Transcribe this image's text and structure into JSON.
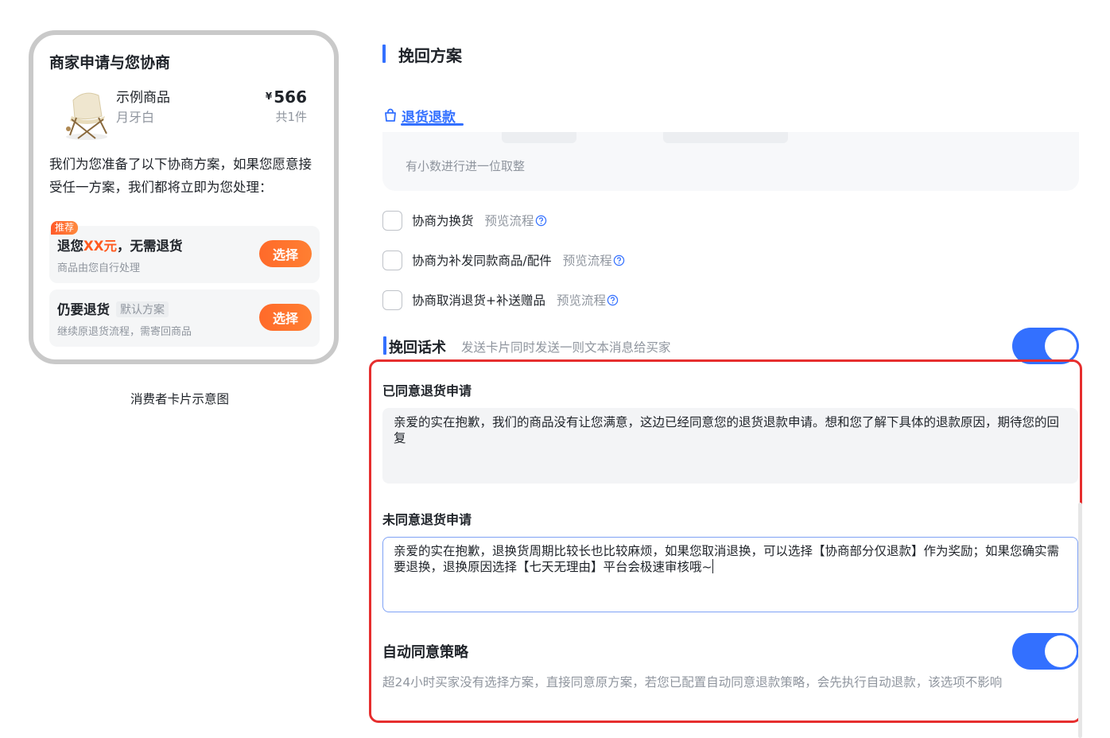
{
  "card": {
    "title": "商家申请与您协商",
    "product_name": "示例商品",
    "product_spec": "月牙白",
    "price_symbol": "¥",
    "price": "566",
    "quantity": "共1件",
    "description": "我们为您准备了以下协商方案，如果您愿意接受任一方案，我们都将立即为您处理：",
    "recommend_tag": "推荐",
    "option1": {
      "title_prefix": "退您",
      "title_amount": "XX元",
      "title_suffix": "，无需退货",
      "subtitle": "商品由您自行处理",
      "button": "选择"
    },
    "option2": {
      "title": "仍要退货",
      "badge": "默认方案",
      "subtitle": "继续原退货流程，需寄回商品",
      "button": "选择"
    },
    "caption": "消费者卡片示意图"
  },
  "panel": {
    "plan_title": "挽回方案",
    "tab_label": "退货退款",
    "clipped_note": "有小数进行进一位取整",
    "checkboxes": [
      {
        "label": "协商为换货",
        "link": "预览流程"
      },
      {
        "label": "协商为补发同款商品/配件",
        "link": "预览流程"
      },
      {
        "label": "协商取消退货+补送赠品",
        "link": "预览流程"
      }
    ],
    "script_title": "挽回话术",
    "script_hint": "发送卡片同时发送一则文本消息给买家",
    "agreed_label": "已同意退货申请",
    "agreed_text": "亲爱的实在抱歉，我们的商品没有让您满意，这边已经同意您的退货退款申请。想和您了解下具体的退款原因，期待您的回复",
    "not_agreed_label": "未同意退货申请",
    "not_agreed_text": "亲爱的实在抱歉，退换货周期比较长也比较麻烦，如果您取消退换，可以选择【协商部分仅退款】作为奖励；如果您确实需要退换，退换原因选择【七天无理由】平台会极速审核哦~",
    "auto_title": "自动同意策略",
    "auto_desc": "超24小时买家没有选择方案，直接同意原方案，若您已配置自动同意退款策略，会先执行自动退款，该选项不影响"
  },
  "colors": {
    "primary": "#3370ff",
    "orange": "#ff6a2a",
    "highlight_red": "#e62e2e"
  }
}
